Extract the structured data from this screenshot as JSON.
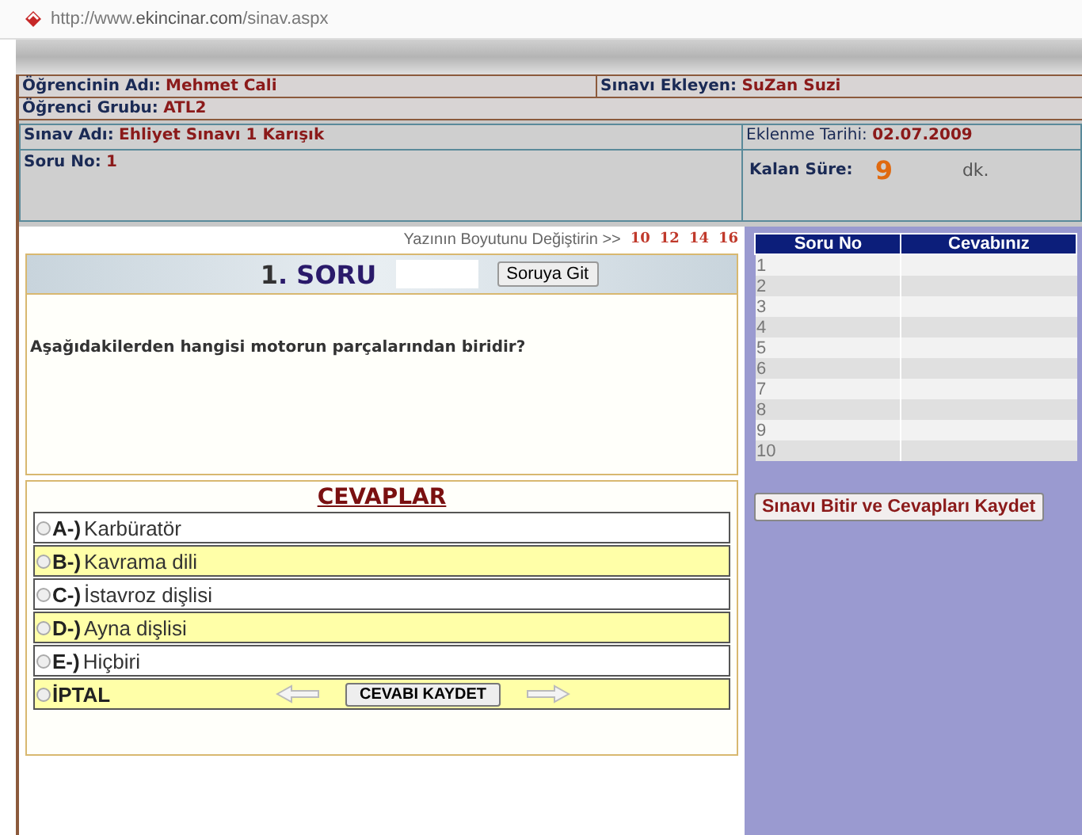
{
  "address_bar": {
    "url_prefix": "http://www.",
    "url_host": "ekincinar.com",
    "url_path": "/sinav.aspx"
  },
  "info": {
    "student_label": "Öğrencinin Adı:",
    "student": "Mehmet Cali",
    "author_label": "Sınavı Ekleyen:",
    "author": "SuZan Suzi",
    "group_label": "Öğrenci Grubu:",
    "group": "ATL2",
    "exam_label": "Sınav Adı:",
    "exam": "Ehliyet Sınavı 1 Karışık",
    "date_label": "Eklenme Tarihi:",
    "date": "02.07.2009",
    "question_label": "Soru No:",
    "question_no": "1",
    "time_label": "Kalan Süre:",
    "time": "9",
    "time_unit": "dk."
  },
  "font_size": {
    "label": "Yazının Boyutunu Değiştirin >>",
    "sizes": [
      "10",
      "12",
      "14",
      "16"
    ]
  },
  "question": {
    "number": "1",
    "dot": ".",
    "title": "SORU",
    "goto_button": "Soruya Git",
    "text": "Aşağıdakilerden hangisi motorun parçalarından biridir?"
  },
  "answers": {
    "title": "CEVAPLAR",
    "options": [
      {
        "letter": "A-)",
        "text": "Karbüratör",
        "selected": false
      },
      {
        "letter": "B-)",
        "text": "Kavrama dili",
        "selected": false
      },
      {
        "letter": "C-)",
        "text": "İstavroz dişlisi",
        "selected": false
      },
      {
        "letter": "D-)",
        "text": "Ayna dişlisi",
        "selected": false
      },
      {
        "letter": "E-)",
        "text": "Hiçbiri",
        "selected": false
      }
    ],
    "cancel": {
      "text": "İPTAL",
      "selected": false
    },
    "save_button": "CEVABI KAYDET"
  },
  "answer_table": {
    "columns": [
      "Soru No",
      "Cevabınız"
    ],
    "rows": [
      {
        "no": "1"
      },
      {
        "no": "2"
      },
      {
        "no": "3"
      },
      {
        "no": "4"
      },
      {
        "no": "5"
      },
      {
        "no": "6"
      },
      {
        "no": "7"
      },
      {
        "no": "8"
      },
      {
        "no": "9"
      },
      {
        "no": "10"
      }
    ]
  },
  "finish_button": "Sınavı Bitir ve Cevapları Kaydet"
}
